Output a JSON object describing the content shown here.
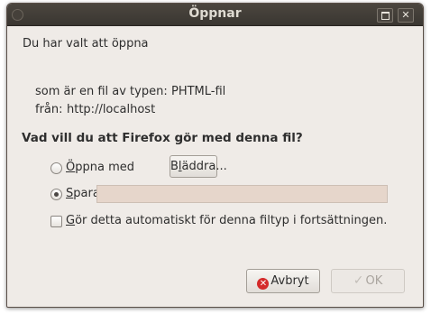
{
  "window": {
    "title": "Öppnar"
  },
  "dialog": {
    "intro": "Du har valt att öppna",
    "type_label": "som är en fil av typen:",
    "type_value": "PHTML-fil",
    "from_label": "från:",
    "from_value": "http://localhost",
    "question": "Vad vill du att Firefox gör med denna fil?"
  },
  "options": {
    "open_with": {
      "mnemonic": "Ö",
      "rest": "ppna med",
      "selected": false
    },
    "browse": {
      "pre": "B",
      "mnemonic": "l",
      "rest": "äddra..."
    },
    "save_file": {
      "mnemonic": "S",
      "rest": "para fil",
      "selected": true
    },
    "auto": {
      "mnemonic": "G",
      "rest": "ör detta automatiskt för denna filtyp i fortsättningen.",
      "checked": false
    }
  },
  "buttons": {
    "cancel": "Avbryt",
    "ok": "OK",
    "ok_enabled": false
  }
}
